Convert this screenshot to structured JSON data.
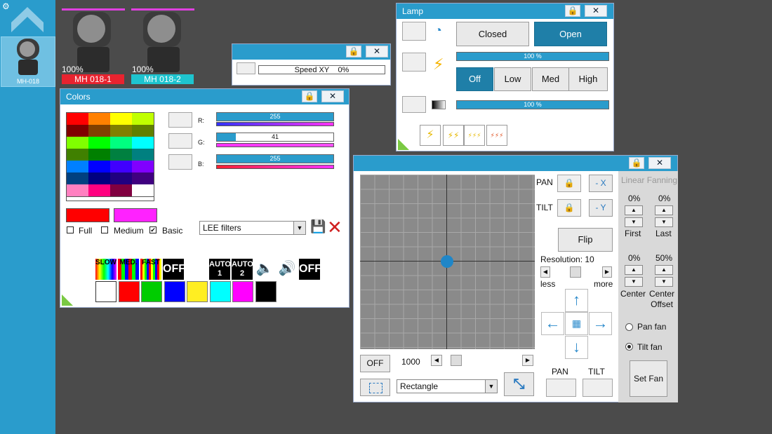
{
  "sidebar": {
    "device_label": "MH-018"
  },
  "fixtures": [
    {
      "percent": "100%",
      "label": "MH 018-1",
      "label_color": "#e8232f"
    },
    {
      "percent": "100%",
      "label": "MH 018-2",
      "label_color": "#1ec4cf"
    }
  ],
  "speed_window": {
    "speed_label": "Speed XY",
    "speed_value": "0%"
  },
  "colors_window": {
    "title": "Colors",
    "grid": [
      "#ff0000",
      "#ff8000",
      "#ffff00",
      "#c0ff00",
      "#800000",
      "#804000",
      "#808000",
      "#608000",
      "#80ff00",
      "#00ff00",
      "#00ff80",
      "#00ffff",
      "#408000",
      "#008000",
      "#008040",
      "#008080",
      "#0080ff",
      "#0000ff",
      "#4000ff",
      "#8000ff",
      "#004080",
      "#000080",
      "#200080",
      "#400080",
      "#ff80c0",
      "#ff0080",
      "#800040",
      "#ffffff"
    ],
    "r_label": "R:",
    "g_label": "G:",
    "b_label": "B:",
    "r_value": "255",
    "g_value": "41",
    "b_value": "255",
    "r_fraction": 1.0,
    "g_fraction": 0.16,
    "b_fraction": 1.0,
    "swatch1": "#ff0000",
    "swatch2": "#ff22ff",
    "check_full": "Full",
    "check_medium": "Medium",
    "check_basic": "Basic",
    "filter_select": "LEE filters",
    "effects": [
      "SLOW",
      "MED.",
      "FAST",
      "OFF",
      "AUTO 1",
      "AUTO 2",
      "OFF"
    ],
    "presets": [
      "#ffffff",
      "#ff0000",
      "#00cc00",
      "#0000ff",
      "#ffee22",
      "#00ffff",
      "#ff00ff",
      "#000000"
    ]
  },
  "lamp_window": {
    "title": "Lamp",
    "closed": "Closed",
    "open": "Open",
    "intensity": "100 %",
    "off": "Off",
    "low": "Low",
    "med": "Med",
    "high": "High",
    "dimmer": "100 %"
  },
  "xy_window": {
    "pan": "PAN",
    "tilt": "TILT",
    "minus_x": "- X",
    "minus_y": "- Y",
    "flip": "Flip",
    "resolution": "Resolution: 10",
    "less": "less",
    "more": "more",
    "off": "OFF",
    "value": "1000",
    "shape": "Rectangle",
    "pan_bottom": "PAN",
    "tilt_bottom": "TILT",
    "fanning_title": "Linear Fanning",
    "first_pct": "0%",
    "last_pct": "0%",
    "first": "First",
    "last": "Last",
    "center_pct": "0%",
    "offset_pct": "50%",
    "center": "Center",
    "center_offset": "Center\nOffset",
    "pan_fan": "Pan fan",
    "tilt_fan": "Tilt fan",
    "set_fan": "Set Fan"
  }
}
